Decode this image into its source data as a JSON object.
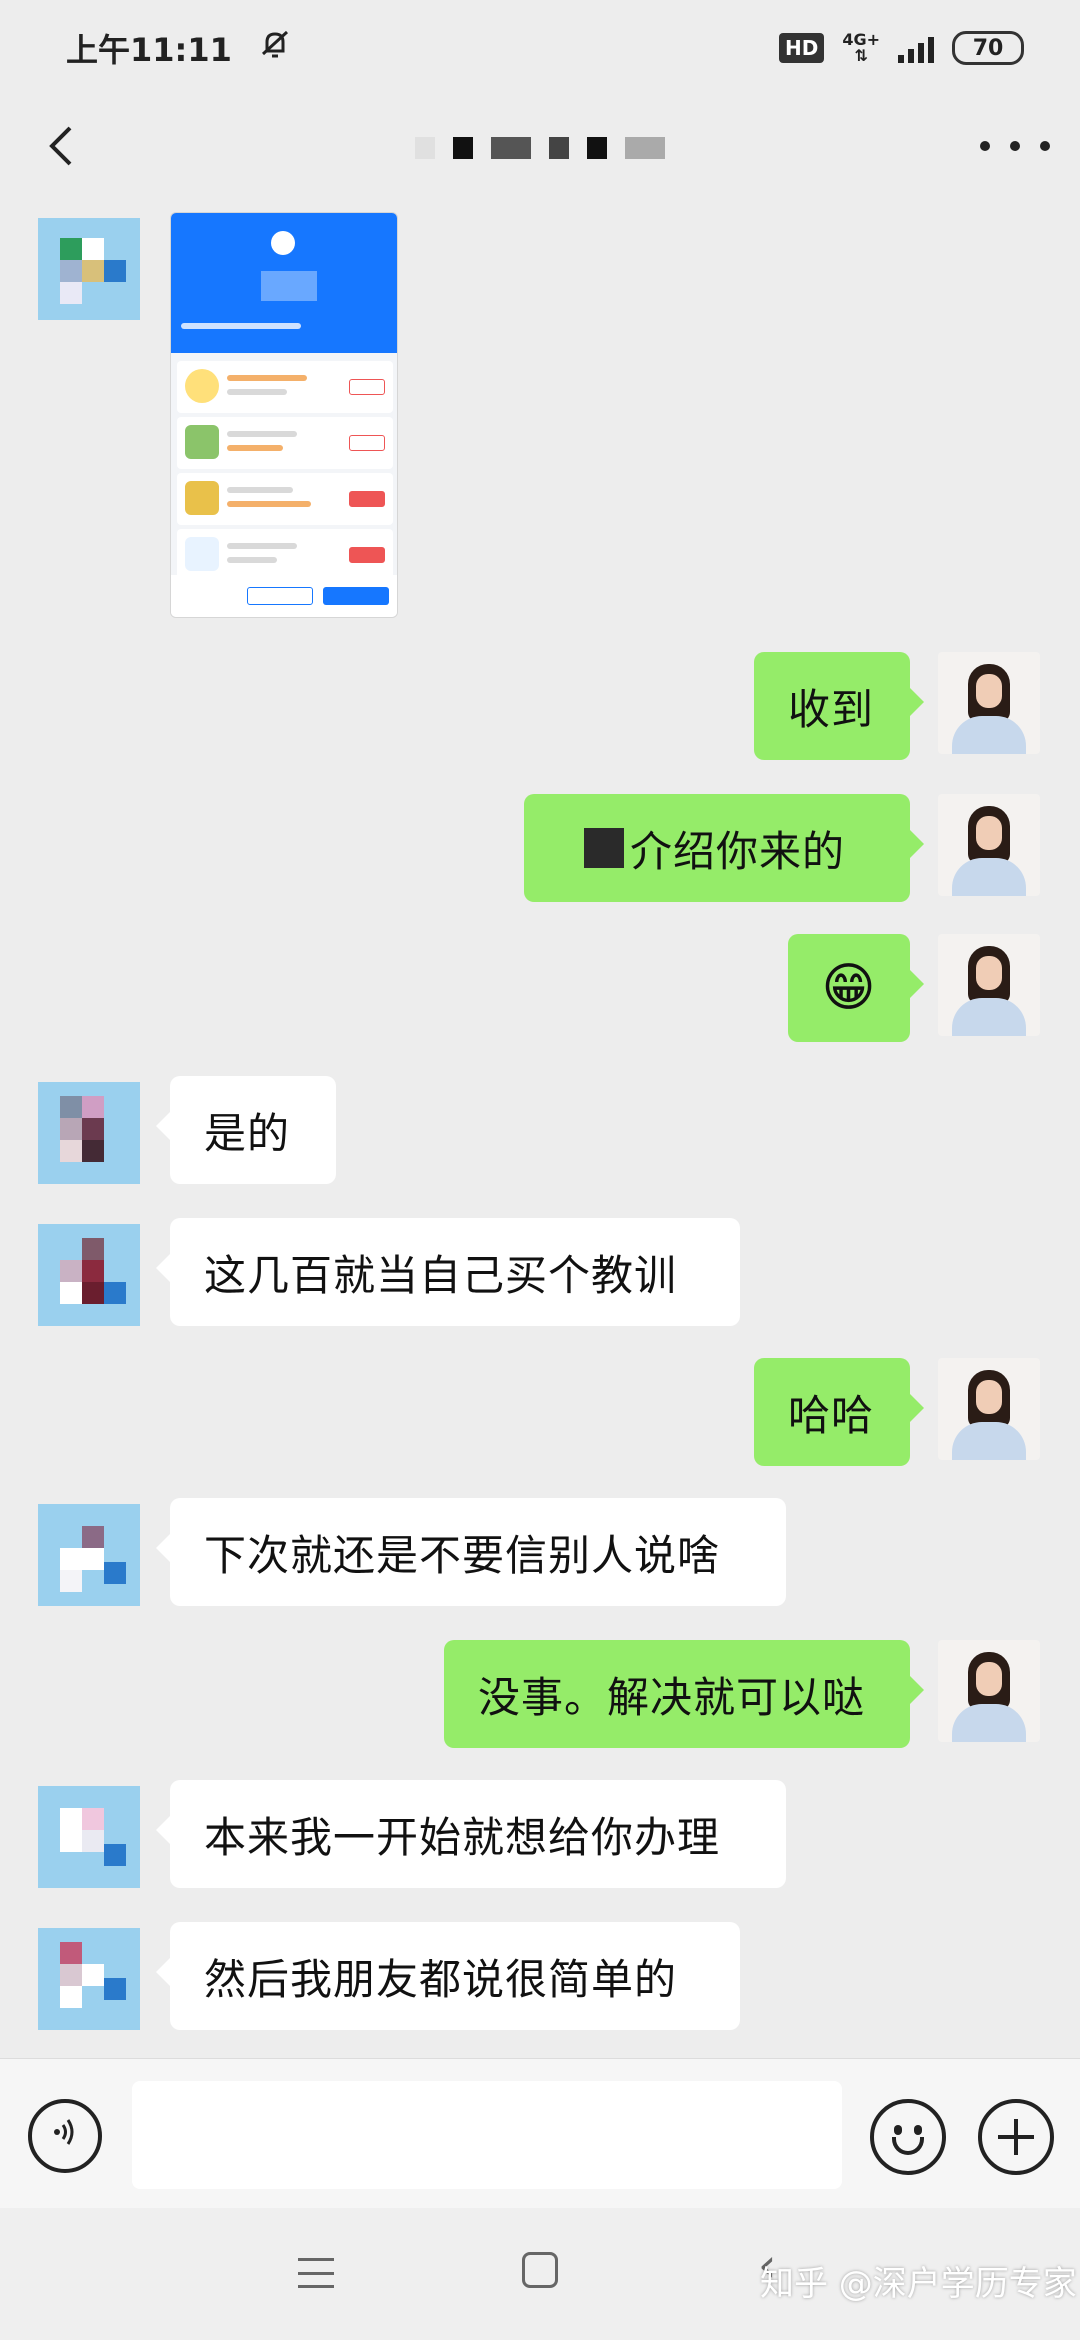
{
  "status_bar": {
    "time": "上午11:11",
    "hd": "HD",
    "network": "4G+",
    "battery": "70"
  },
  "nav": {
    "back_icon": "chevron-left-icon",
    "more_icon": "more-dots-icon",
    "title": ""
  },
  "messages": [
    {
      "side": "left",
      "type": "image"
    },
    {
      "side": "right",
      "type": "text",
      "text": "收到"
    },
    {
      "side": "right",
      "type": "text",
      "text": "介绍你来的"
    },
    {
      "side": "right",
      "type": "emoji",
      "text": "😁"
    },
    {
      "side": "left",
      "type": "text",
      "text": "是的"
    },
    {
      "side": "left",
      "type": "text",
      "text": "这几百就当自己买个教训"
    },
    {
      "side": "right",
      "type": "text",
      "text": "哈哈"
    },
    {
      "side": "left",
      "type": "text",
      "text": "下次就还是不要信别人说啥"
    },
    {
      "side": "right",
      "type": "text",
      "text": "没事。解决就可以哒"
    },
    {
      "side": "left",
      "type": "text",
      "text": "本来我一开始就想给你办理"
    },
    {
      "side": "left",
      "type": "text",
      "text": "然后我朋友都说很简单的"
    }
  ],
  "input_bar": {
    "voice_icon": "voice-icon",
    "emoji_icon": "emoji-icon",
    "plus_icon": "plus-icon",
    "placeholder": ""
  },
  "system_nav": {
    "back_glyph": "‹"
  },
  "watermark": "知乎 @深户学历专家",
  "colors": {
    "background": "#ededed",
    "bubble_right": "#95ec69",
    "bubble_left": "#ffffff"
  }
}
